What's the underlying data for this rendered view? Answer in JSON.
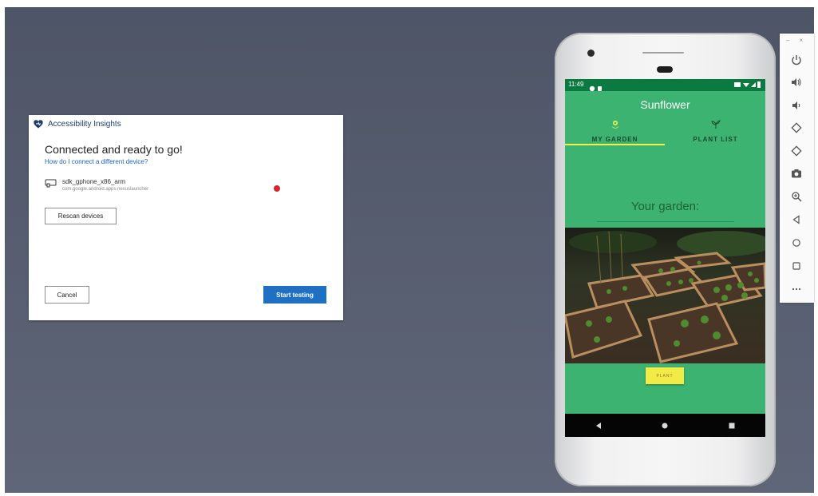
{
  "dialog": {
    "app_title": "Accessibility Insights",
    "heading": "Connected and ready to go!",
    "help_link": "How do I connect a different device?",
    "device_name": "sdk_gphone_x86_arm",
    "device_package": "com.google.android.apps.nexuslauncher",
    "rescan_label": "Rescan devices",
    "cancel_label": "Cancel",
    "start_label": "Start testing"
  },
  "phone": {
    "status_time": "11:49",
    "app_title": "Sunflower",
    "tabs": [
      {
        "label": "MY GARDEN",
        "icon": "sprout-icon",
        "selected": true
      },
      {
        "label": "PLANT LIST",
        "icon": "plant-icon",
        "selected": false
      }
    ],
    "your_garden": "Your garden:",
    "plant_button": "PLANT",
    "nav": [
      "back-icon",
      "home-icon",
      "recents-icon"
    ]
  },
  "toolbar": {
    "window_controls": [
      "–",
      "×"
    ],
    "tools": [
      "power-icon",
      "volume-up-icon",
      "volume-down-icon",
      "rotate-left-icon",
      "rotate-right-icon",
      "camera-icon",
      "zoom-icon",
      "back-icon",
      "home-icon",
      "overview-icon",
      "more-icon"
    ]
  },
  "colors": {
    "app_green": "#3cb371",
    "status_green": "#0b7a40",
    "tab_indicator": "#f2ee4a",
    "primary_button": "#1f6fc3",
    "cursor_red": "#d9232e"
  }
}
